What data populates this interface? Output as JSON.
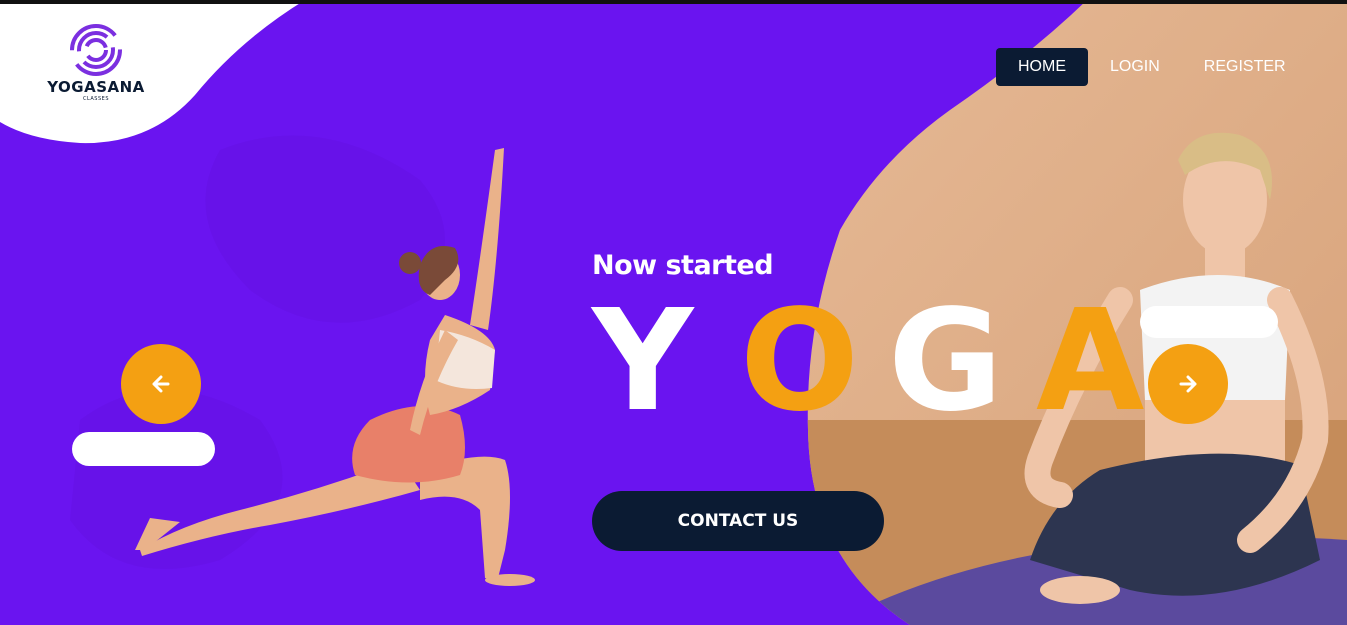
{
  "brand": {
    "name": "YOGASANA",
    "tagline": "CLASSES"
  },
  "nav": {
    "items": [
      {
        "label": "HOME",
        "active": true
      },
      {
        "label": "LOGIN",
        "active": false
      },
      {
        "label": "REGISTER",
        "active": false
      }
    ]
  },
  "hero": {
    "subtitle": "Now started",
    "headline_letters": [
      "Y",
      "O",
      "G",
      "A"
    ],
    "cta_label": "CONTACT US"
  },
  "carousel": {
    "prev_icon": "arrow-left-icon",
    "next_icon": "arrow-right-icon",
    "prev_glyph": "🡐",
    "next_glyph": "🡒"
  },
  "colors": {
    "primary": "#6a14f0",
    "accent": "#f4a012",
    "dark": "#0b1b33",
    "white": "#ffffff"
  }
}
